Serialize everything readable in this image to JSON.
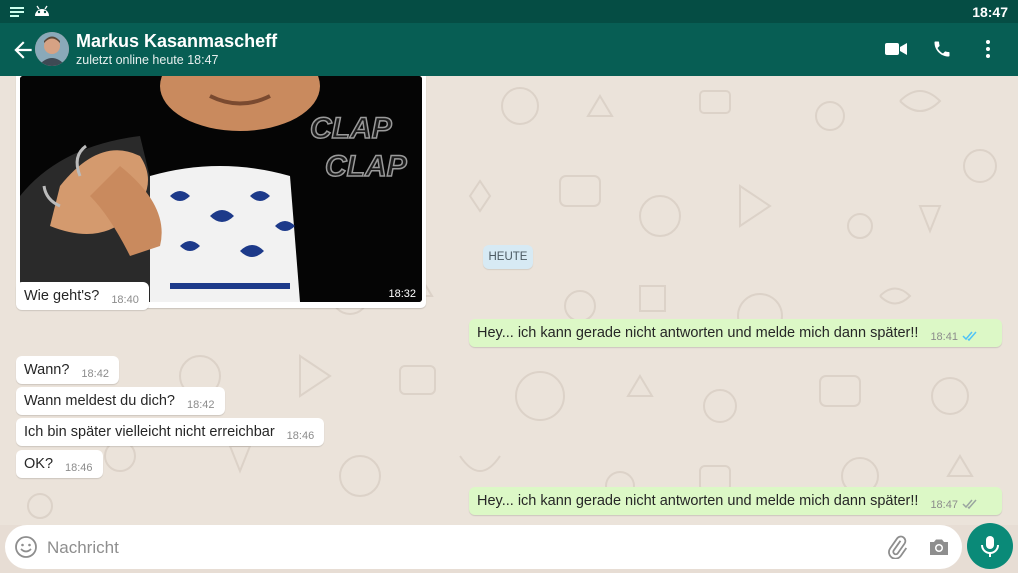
{
  "status_bar": {
    "time": "18:47"
  },
  "header": {
    "contact_name": "Markus Kasanmascheff",
    "contact_status": "zuletzt online heute 18:47"
  },
  "image_message": {
    "time": "18:32",
    "overlay_text": [
      "CLAP",
      "CLAP"
    ]
  },
  "date_chip": "HEUTE",
  "messages": [
    {
      "dir": "in",
      "text": "Wie geht's?",
      "time": "18:40"
    },
    {
      "dir": "out",
      "text": "Hey... ich kann gerade nicht antworten und melde mich dann später!!",
      "time": "18:41",
      "status": "read"
    },
    {
      "dir": "in",
      "text": "Wann?",
      "time": "18:42"
    },
    {
      "dir": "in",
      "text": "Wann meldest du dich?",
      "time": "18:42"
    },
    {
      "dir": "in",
      "text": "Ich bin später vielleicht nicht erreichbar",
      "time": "18:46"
    },
    {
      "dir": "in",
      "text": "OK?",
      "time": "18:46"
    },
    {
      "dir": "out",
      "text": "Hey... ich kann gerade nicht antworten und melde mich dann später!!",
      "time": "18:47",
      "status": "delivered"
    }
  ],
  "composer": {
    "placeholder": "Nachricht"
  },
  "colors": {
    "header": "#075e54",
    "status_bar": "#054d44",
    "outgoing_bubble": "#dcf8c6",
    "incoming_bubble": "#ffffff",
    "mic_button": "#0a8a78",
    "read_ticks": "#4fc3f7"
  },
  "icons": [
    "notification-icon",
    "android-icon",
    "back-arrow-icon",
    "video-call-icon",
    "phone-icon",
    "more-vert-icon",
    "emoji-icon",
    "attach-icon",
    "camera-icon",
    "mic-icon",
    "double-check-icon"
  ]
}
